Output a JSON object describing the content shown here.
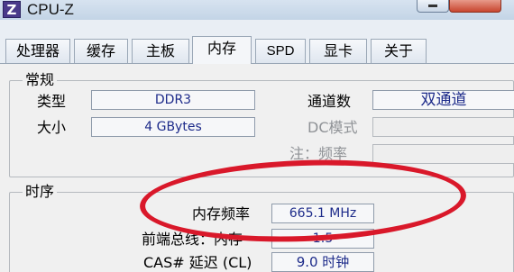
{
  "window": {
    "app_icon": "Z",
    "title": "CPU-Z"
  },
  "tabs": [
    {
      "label": "处理器"
    },
    {
      "label": "缓存"
    },
    {
      "label": "主板"
    },
    {
      "label": "内存"
    },
    {
      "label": "SPD"
    },
    {
      "label": "显卡"
    },
    {
      "label": "关于"
    }
  ],
  "general": {
    "title": "常规",
    "type_label": "类型",
    "type_value": "DDR3",
    "size_label": "大小",
    "size_value": "4 GBytes",
    "channels_label": "通道数",
    "channels_value": "双通道",
    "dc_mode_label": "DC模式",
    "note_freq_label": "注：频率"
  },
  "timings": {
    "title": "时序",
    "dram_freq_label": "内存频率",
    "dram_freq_value": "665.1 MHz",
    "fsb_dram_label": "前端总线：内存",
    "fsb_dram_value": "1:5",
    "cas_label": "CAS# 延迟 (CL)",
    "cas_value": "9.0 时钟"
  },
  "colors": {
    "highlight_oval": "#d9182a",
    "field_text": "#1d2b8a"
  }
}
